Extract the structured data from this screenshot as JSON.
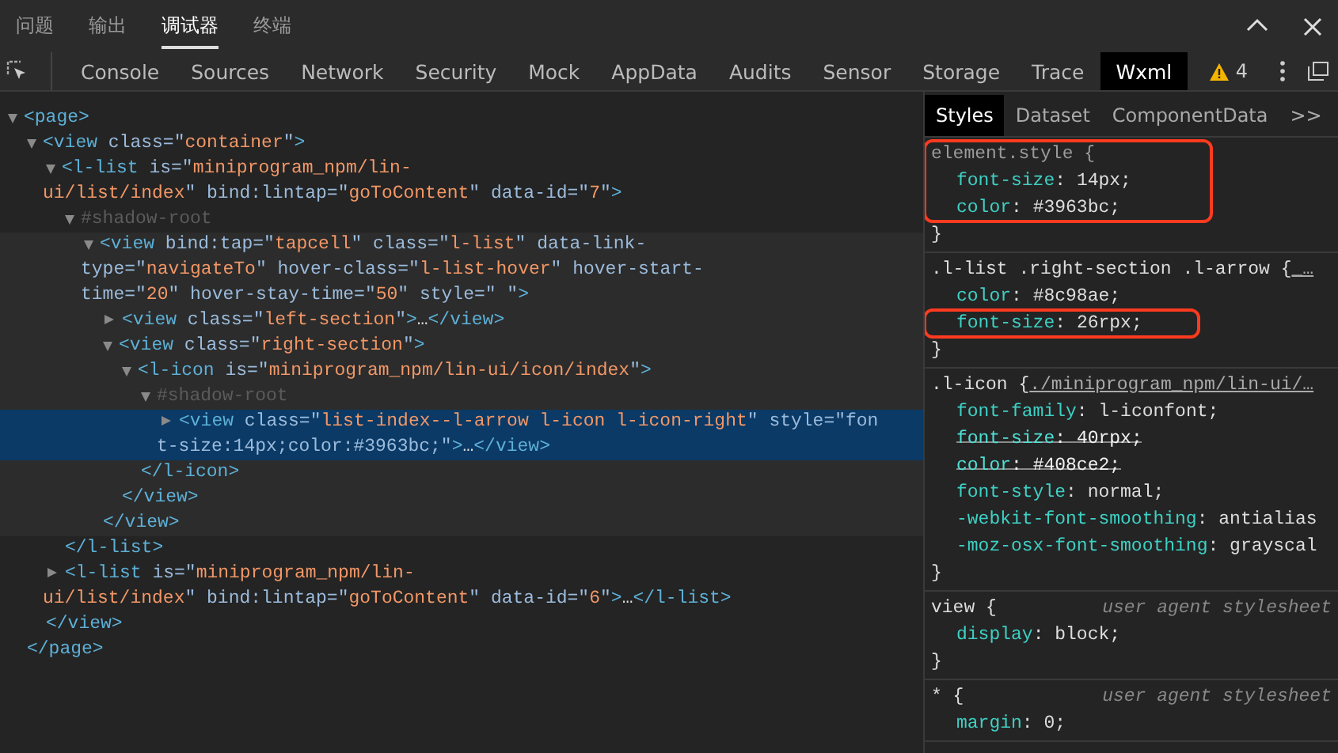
{
  "top_tabs": [
    {
      "label": "问题",
      "selected": false
    },
    {
      "label": "输出",
      "selected": false
    },
    {
      "label": "调试器",
      "selected": true
    },
    {
      "label": "终端",
      "selected": false
    }
  ],
  "panel_tabs": [
    {
      "label": "Console",
      "selected": false
    },
    {
      "label": "Sources",
      "selected": false
    },
    {
      "label": "Network",
      "selected": false
    },
    {
      "label": "Security",
      "selected": false
    },
    {
      "label": "Mock",
      "selected": false
    },
    {
      "label": "AppData",
      "selected": false
    },
    {
      "label": "Audits",
      "selected": false
    },
    {
      "label": "Sensor",
      "selected": false
    },
    {
      "label": "Storage",
      "selected": false
    },
    {
      "label": "Trace",
      "selected": false
    },
    {
      "label": "Wxml",
      "selected": true
    }
  ],
  "warnings": {
    "count": "4"
  },
  "dom_tree": [
    {
      "expanded": true,
      "selected": false,
      "hovered": false,
      "lines": [
        [
          {
            "kind": "tag",
            "text": "<page>"
          }
        ]
      ],
      "close": [
        {
          "kind": "tag",
          "text": "</page>"
        }
      ],
      "children": [
        {
          "expanded": true,
          "selected": false,
          "hovered": false,
          "lines": [
            [
              {
                "kind": "tag",
                "text": "<view"
              },
              {
                "kind": "attr",
                "text": " class=\""
              },
              {
                "kind": "val",
                "text": "container"
              },
              {
                "kind": "attr",
                "text": "\""
              },
              {
                "kind": "tag",
                "text": ">"
              }
            ]
          ],
          "close": [
            {
              "kind": "tag",
              "text": "</view>"
            }
          ],
          "children": [
            {
              "expanded": true,
              "selected": false,
              "hovered": false,
              "lines": [
                [
                  {
                    "kind": "tag",
                    "text": "<l-list"
                  },
                  {
                    "kind": "attr",
                    "text": " is=\""
                  },
                  {
                    "kind": "val",
                    "text": "miniprogram_npm/lin-"
                  }
                ],
                [
                  {
                    "kind": "val",
                    "text": "ui/list/index"
                  },
                  {
                    "kind": "attr",
                    "text": "\" bind:lintap=\""
                  },
                  {
                    "kind": "val",
                    "text": "goToContent"
                  },
                  {
                    "kind": "attr",
                    "text": "\" data-id=\""
                  },
                  {
                    "kind": "val",
                    "text": "7"
                  },
                  {
                    "kind": "attr",
                    "text": "\""
                  },
                  {
                    "kind": "tag",
                    "text": ">"
                  }
                ]
              ],
              "close": [
                {
                  "kind": "tag",
                  "text": "</l-list>"
                }
              ],
              "children": [
                {
                  "expanded": true,
                  "selected": false,
                  "hovered": false,
                  "lines": [
                    [
                      {
                        "kind": "shadow",
                        "text": "#shadow-root"
                      }
                    ]
                  ],
                  "children": [
                    {
                      "expanded": true,
                      "selected": false,
                      "hovered": true,
                      "lines": [
                        [
                          {
                            "kind": "tag",
                            "text": "<view"
                          },
                          {
                            "kind": "attr",
                            "text": " bind:tap=\""
                          },
                          {
                            "kind": "val",
                            "text": "tapcell"
                          },
                          {
                            "kind": "attr",
                            "text": "\" class=\""
                          },
                          {
                            "kind": "val",
                            "text": "l-list"
                          },
                          {
                            "kind": "attr",
                            "text": "\" data-link-"
                          }
                        ],
                        [
                          {
                            "kind": "attr",
                            "text": "type=\""
                          },
                          {
                            "kind": "val",
                            "text": "navigateTo"
                          },
                          {
                            "kind": "attr",
                            "text": "\" hover-class=\""
                          },
                          {
                            "kind": "val",
                            "text": "l-list-hover"
                          },
                          {
                            "kind": "attr",
                            "text": "\" hover-start-"
                          }
                        ],
                        [
                          {
                            "kind": "attr",
                            "text": "time=\""
                          },
                          {
                            "kind": "val",
                            "text": "20"
                          },
                          {
                            "kind": "attr",
                            "text": "\" hover-stay-time=\""
                          },
                          {
                            "kind": "val",
                            "text": "50"
                          },
                          {
                            "kind": "attr",
                            "text": "\" style=\" \""
                          },
                          {
                            "kind": "tag",
                            "text": ">"
                          }
                        ]
                      ],
                      "close": [
                        {
                          "kind": "tag",
                          "text": "</view>"
                        }
                      ],
                      "children": [
                        {
                          "expanded": false,
                          "selected": false,
                          "hovered": false,
                          "lines": [
                            [
                              {
                                "kind": "tag",
                                "text": "<view"
                              },
                              {
                                "kind": "attr",
                                "text": " class=\""
                              },
                              {
                                "kind": "val",
                                "text": "left-section"
                              },
                              {
                                "kind": "attr",
                                "text": "\""
                              },
                              {
                                "kind": "tag",
                                "text": ">"
                              },
                              {
                                "kind": "text",
                                "text": "…"
                              },
                              {
                                "kind": "tag",
                                "text": "</view>"
                              }
                            ]
                          ]
                        },
                        {
                          "expanded": true,
                          "selected": false,
                          "hovered": false,
                          "lines": [
                            [
                              {
                                "kind": "tag",
                                "text": "<view"
                              },
                              {
                                "kind": "attr",
                                "text": " class=\""
                              },
                              {
                                "kind": "val",
                                "text": "right-section"
                              },
                              {
                                "kind": "attr",
                                "text": "\""
                              },
                              {
                                "kind": "tag",
                                "text": ">"
                              }
                            ]
                          ],
                          "close": [
                            {
                              "kind": "tag",
                              "text": "</view>"
                            }
                          ],
                          "children": [
                            {
                              "expanded": true,
                              "selected": false,
                              "hovered": false,
                              "lines": [
                                [
                                  {
                                    "kind": "tag",
                                    "text": "<l-icon"
                                  },
                                  {
                                    "kind": "attr",
                                    "text": " is=\""
                                  },
                                  {
                                    "kind": "val",
                                    "text": "miniprogram_npm/lin-ui/icon/index"
                                  },
                                  {
                                    "kind": "attr",
                                    "text": "\""
                                  },
                                  {
                                    "kind": "tag",
                                    "text": ">"
                                  }
                                ]
                              ],
                              "close": [
                                {
                                  "kind": "tag",
                                  "text": "</l-icon>"
                                }
                              ],
                              "children": [
                                {
                                  "expanded": true,
                                  "selected": false,
                                  "hovered": false,
                                  "lines": [
                                    [
                                      {
                                        "kind": "shadow",
                                        "text": "#shadow-root"
                                      }
                                    ]
                                  ],
                                  "children": [
                                    {
                                      "expanded": false,
                                      "selected": true,
                                      "hovered": false,
                                      "lines": [
                                        [
                                          {
                                            "kind": "tag",
                                            "text": "<view"
                                          },
                                          {
                                            "kind": "attr",
                                            "text": " class=\""
                                          },
                                          {
                                            "kind": "val",
                                            "text": "list-index--l-arrow l-icon l-icon-right"
                                          },
                                          {
                                            "kind": "attr",
                                            "text": "\" style=\"fon"
                                          }
                                        ],
                                        [
                                          {
                                            "kind": "attr",
                                            "text": "t-size:14px;color:#3963bc;\""
                                          },
                                          {
                                            "kind": "tag",
                                            "text": ">"
                                          },
                                          {
                                            "kind": "text",
                                            "text": "…"
                                          },
                                          {
                                            "kind": "tag",
                                            "text": "</view>"
                                          }
                                        ]
                                      ]
                                    }
                                  ]
                                }
                              ]
                            }
                          ]
                        }
                      ]
                    }
                  ]
                }
              ]
            },
            {
              "expanded": false,
              "selected": false,
              "hovered": false,
              "lines": [
                [
                  {
                    "kind": "tag",
                    "text": "<l-list"
                  },
                  {
                    "kind": "attr",
                    "text": " is=\""
                  },
                  {
                    "kind": "val",
                    "text": "miniprogram_npm/lin-"
                  }
                ],
                [
                  {
                    "kind": "val",
                    "text": "ui/list/index"
                  },
                  {
                    "kind": "attr",
                    "text": "\" bind:lintap=\""
                  },
                  {
                    "kind": "val",
                    "text": "goToContent"
                  },
                  {
                    "kind": "attr",
                    "text": "\" data-id=\""
                  },
                  {
                    "kind": "val",
                    "text": "6"
                  },
                  {
                    "kind": "attr",
                    "text": "\""
                  },
                  {
                    "kind": "tag",
                    "text": ">"
                  },
                  {
                    "kind": "text",
                    "text": "…"
                  },
                  {
                    "kind": "tag",
                    "text": "</l-list>"
                  }
                ]
              ]
            }
          ]
        }
      ]
    }
  ],
  "styles_tabs": [
    {
      "label": "Styles",
      "selected": true
    },
    {
      "label": "Dataset",
      "selected": false
    },
    {
      "label": "ComponentData",
      "selected": false
    },
    {
      "label": ">>",
      "selected": false
    }
  ],
  "rules": [
    {
      "kind": "inline",
      "selector": "element.style {",
      "highlighted": true,
      "close": "}",
      "props": [
        {
          "name": "font-size:",
          "value": "14px;",
          "struck": false,
          "highlighted": false
        },
        {
          "name": "color:",
          "value": "#3963bc;",
          "struck": false,
          "highlighted": false
        }
      ]
    },
    {
      "kind": "sheet",
      "selector": ".l-list .right-section .l-arrow {",
      "source": "_…",
      "highlighted": false,
      "close": "}",
      "props": [
        {
          "name": "color:",
          "value": "#8c98ae;",
          "struck": false,
          "highlighted": false
        },
        {
          "name": "font-size:",
          "value": "26rpx;",
          "struck": false,
          "highlighted": true
        }
      ]
    },
    {
      "kind": "sheet",
      "selector": ".l-icon {",
      "source": "./miniprogram_npm/lin-ui/…",
      "highlighted": false,
      "close": "}",
      "props": [
        {
          "name": "font-family:",
          "value": "l-iconfont;",
          "struck": false,
          "highlighted": false
        },
        {
          "name": "font-size:",
          "value": "40rpx;",
          "struck": true,
          "highlighted": false
        },
        {
          "name": "color:",
          "value": "#408ce2;",
          "struck": true,
          "highlighted": false
        },
        {
          "name": "font-style:",
          "value": "normal;",
          "struck": false,
          "highlighted": false
        },
        {
          "name": "-webkit-font-smoothing:",
          "value": "antialias",
          "struck": false,
          "highlighted": false
        },
        {
          "name": "-moz-osx-font-smoothing:",
          "value": "grayscal",
          "struck": false,
          "highlighted": false
        }
      ]
    },
    {
      "kind": "agent",
      "selector": "view {",
      "comment": "user agent stylesheet",
      "highlighted": false,
      "close": "}",
      "props": [
        {
          "name": "display:",
          "value": "block;",
          "struck": false,
          "highlighted": false
        }
      ]
    },
    {
      "kind": "agent",
      "selector": "* {",
      "comment": "user agent stylesheet",
      "highlighted": false,
      "props": [
        {
          "name": "margin:",
          "value": "0;",
          "struck": false,
          "highlighted": false
        }
      ]
    }
  ]
}
